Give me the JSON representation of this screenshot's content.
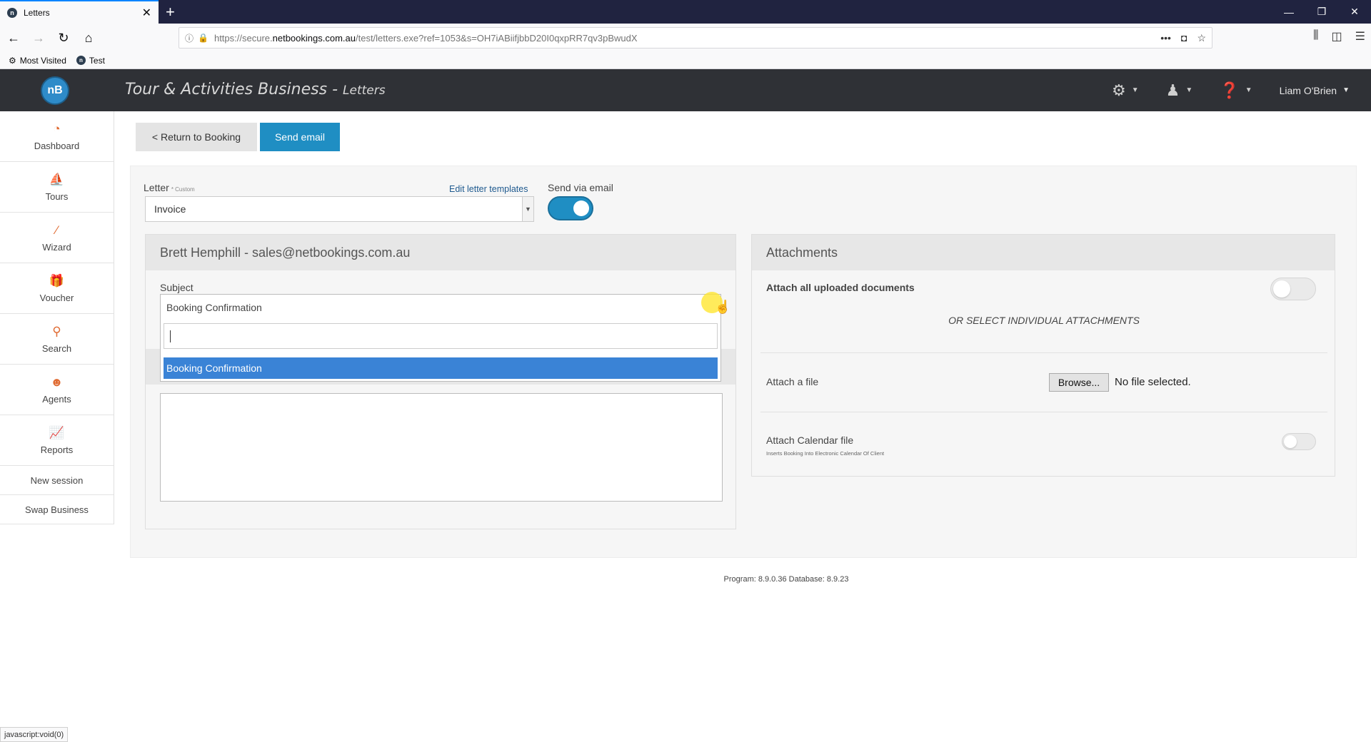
{
  "browser": {
    "tab_title": "Letters",
    "tab_favicon": "n",
    "url_domain": "netbookings.com.au",
    "url_prefix": "https://secure.",
    "url_suffix": "/test/letters.exe?ref=1053&s=OH7iABiifjbbD20I0qxpRR7qv3pBwudX",
    "bookmarks": [
      "Most Visited",
      "Test"
    ],
    "status_text": "javascript:void(0)"
  },
  "header": {
    "logo_text": "nB",
    "business": "Tour & Activities Business",
    "separator": " - ",
    "section": "Letters",
    "user_name": "Liam O'Brien"
  },
  "sidebar": {
    "items": [
      {
        "label": "Dashboard",
        "icon": "dashboard-icon"
      },
      {
        "label": "Tours",
        "icon": "tours-icon"
      },
      {
        "label": "Wizard",
        "icon": "wand-icon"
      },
      {
        "label": "Voucher",
        "icon": "gift-icon"
      },
      {
        "label": "Search",
        "icon": "search-icon"
      },
      {
        "label": "Agents",
        "icon": "agent-icon"
      },
      {
        "label": "Reports",
        "icon": "chart-icon"
      }
    ],
    "links": [
      "New session",
      "Swap Business"
    ]
  },
  "toolbar": {
    "return_label": "< Return to Booking",
    "send_label": "Send email"
  },
  "form": {
    "letter_label": "Letter",
    "letter_note": "* Custom",
    "edit_templates": "Edit letter templates",
    "letter_value": "Invoice",
    "send_via_label": "Send via email",
    "send_via_on": true,
    "recipient": "Brett Hemphill - sales@netbookings.com.au",
    "subject_label": "Subject",
    "subject_value": "Booking Confirmation",
    "dropdown_search": "",
    "dropdown_options": [
      "Booking Confirmation"
    ]
  },
  "attachments": {
    "title": "Attachments",
    "attach_all": "Attach all uploaded documents",
    "attach_all_on": false,
    "or_select": "OR SELECT INDIVIDUAL ATTACHMENTS",
    "attach_file": "Attach a file",
    "browse": "Browse...",
    "no_file": "No file selected.",
    "calendar": "Attach Calendar file",
    "calendar_sub": "Inserts Booking Into Electronic Calendar Of Client",
    "calendar_on": false
  },
  "footer": {
    "version": "Program: 8.9.0.36 Database: 8.9.23"
  },
  "colors": {
    "accent": "#1f8ec3",
    "header_bg": "#2f3136",
    "sidebar_icon": "#e06b32",
    "selected_option": "#3a83d6"
  }
}
